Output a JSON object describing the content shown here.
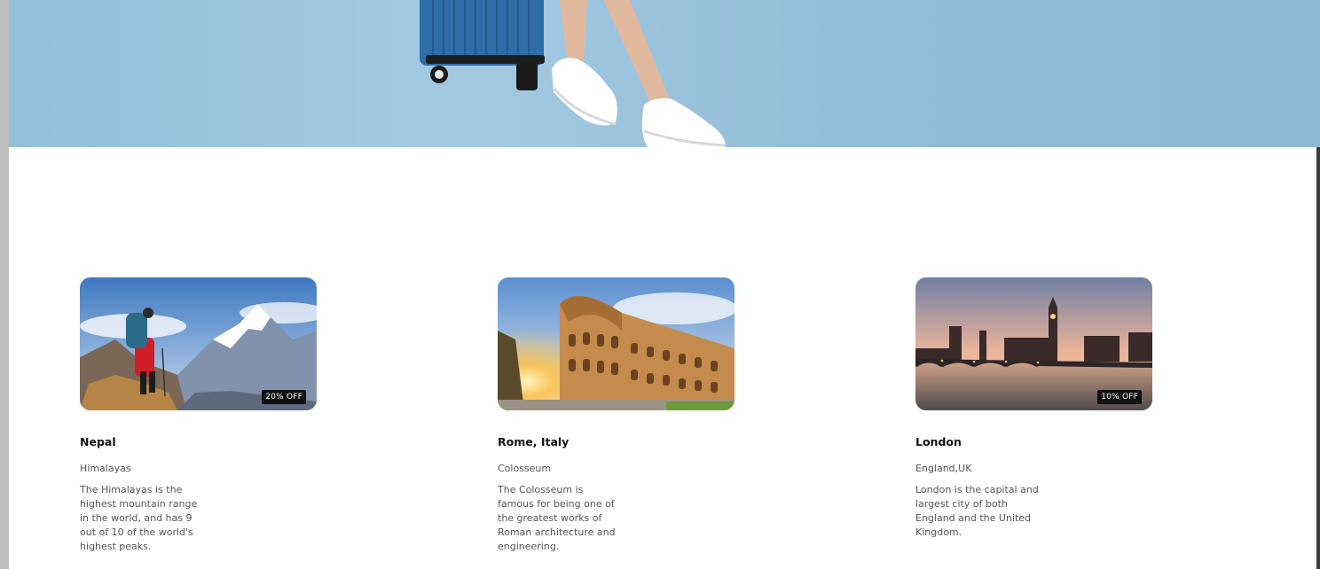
{
  "hero": {
    "background_color": "#94bfdb",
    "image_icon": "traveler-with-suitcase-image"
  },
  "destinations": [
    {
      "title": "Nepal",
      "subtitle": "Himalayas",
      "description": "The Himalayas is the highest mountain range in the world, and has 9 out of 10 of the world's highest peaks.",
      "badge": "20% OFF",
      "image_icon": "mountain-hiker-image"
    },
    {
      "title": "Rome, Italy",
      "subtitle": "Colosseum",
      "description": "The Colosseum is famous for being one of the greatest works of Roman architecture and engineering.",
      "badge": "",
      "image_icon": "colosseum-image"
    },
    {
      "title": "London",
      "subtitle": "England,UK",
      "description": "London is the capital and largest city of both England and the United Kingdom.",
      "badge": "10% OFF",
      "image_icon": "london-skyline-image"
    }
  ]
}
